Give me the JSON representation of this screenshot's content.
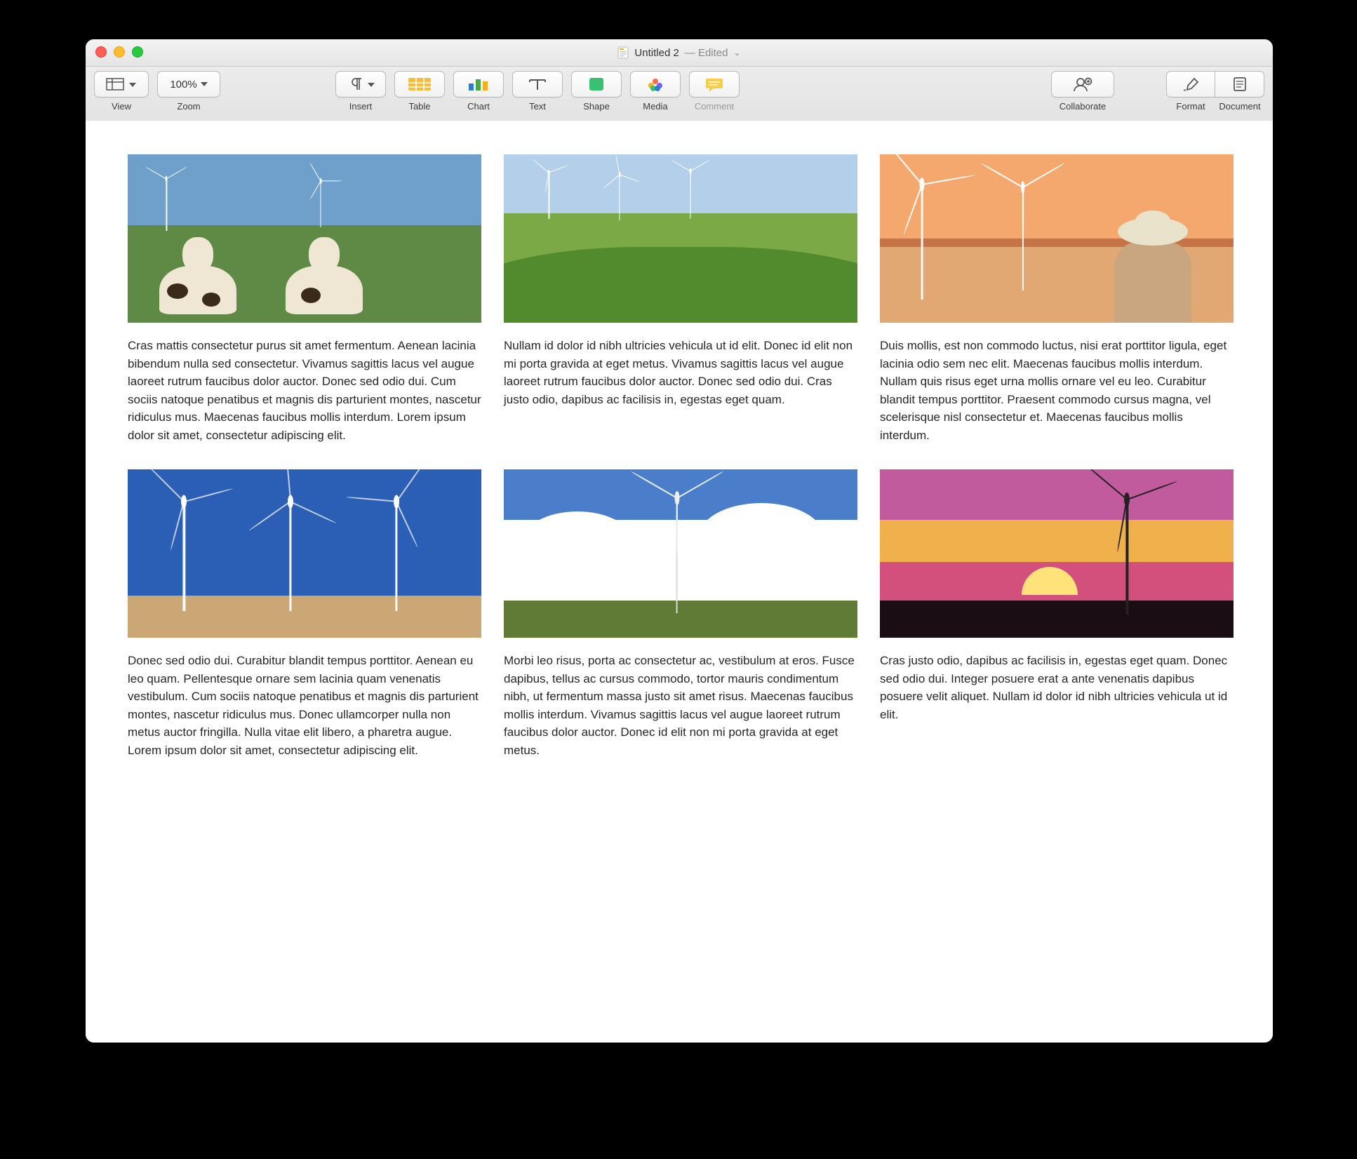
{
  "titlebar": {
    "doc_name": "Untitled 2",
    "edited_suffix": " — Edited"
  },
  "toolbar": {
    "view": "View",
    "zoom_label": "Zoom",
    "zoom_value": "100%",
    "insert": "Insert",
    "table": "Table",
    "chart": "Chart",
    "text": "Text",
    "shape": "Shape",
    "media": "Media",
    "comment": "Comment",
    "collaborate": "Collaborate",
    "format": "Format",
    "document": "Document"
  },
  "cells": [
    {
      "text": "Cras mattis consectetur purus sit amet fermentum. Aenean lacinia bibendum nulla sed consectetur. Vivamus sagittis lacus vel augue laoreet rutrum faucibus dolor auctor. Donec sed odio dui. Cum sociis natoque penatibus et magnis dis parturient montes, nascetur ridiculus mus. Maecenas faucibus mollis interdum. Lorem ipsum dolor sit amet, consectetur adipiscing elit."
    },
    {
      "text": "Nullam id dolor id nibh ultricies vehicula ut id elit. Donec id elit non mi porta gravida at eget metus. Vivamus sagittis lacus vel augue laoreet rutrum faucibus dolor auctor. Donec sed odio dui. Cras justo odio, dapibus ac facilisis in, egestas eget quam."
    },
    {
      "text": "Duis mollis, est non commodo luctus, nisi erat porttitor ligula, eget lacinia odio sem nec elit. Maecenas faucibus mollis interdum. Nullam quis risus eget urna mollis ornare vel eu leo. Curabitur blandit tempus porttitor. Praesent commodo cursus magna, vel scelerisque nisl consectetur et. Maecenas faucibus mollis interdum."
    },
    {
      "text": "Donec sed odio dui. Curabitur blandit tempus porttitor. Aenean eu leo quam. Pellentesque ornare sem lacinia quam venenatis vestibulum. Cum sociis natoque penatibus et magnis dis parturient montes, nascetur ridiculus mus. Donec ullamcorper nulla non metus auctor fringilla. Nulla vitae elit libero, a pharetra augue. Lorem ipsum dolor sit amet, consectetur adipiscing elit."
    },
    {
      "text": "Morbi leo risus, porta ac consectetur ac, vestibulum at eros. Fusce dapibus, tellus ac cursus commodo, tortor mauris condimentum nibh, ut fermentum massa justo sit amet risus. Maecenas faucibus mollis interdum. Vivamus sagittis lacus vel augue laoreet rutrum faucibus dolor auctor. Donec id elit non mi porta gravida at eget metus."
    },
    {
      "text": "Cras justo odio, dapibus ac facilisis in, egestas eget quam. Donec sed odio dui. Integer posuere erat a ante venenatis dapibus posuere velit aliquet. Nullam id dolor id nibh ultricies vehicula ut id elit."
    }
  ]
}
